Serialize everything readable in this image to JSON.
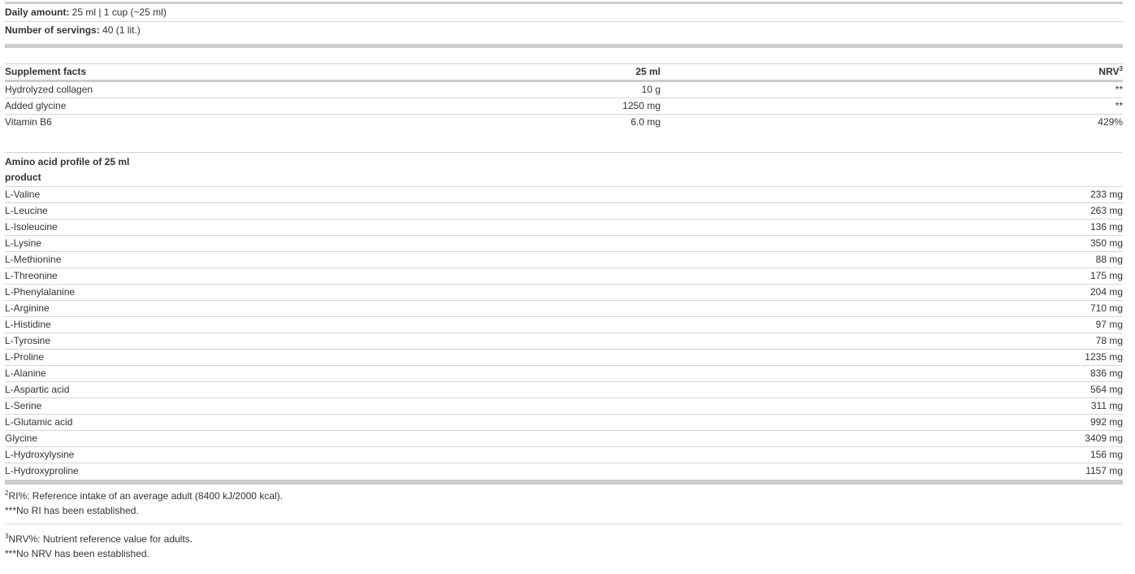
{
  "daily": {
    "label": "Daily amount:",
    "value": " 25 ml | 1 cup (~25 ml)"
  },
  "servings": {
    "label": "Number of servings:",
    "value": " 40 (1 lit.)"
  },
  "supplement": {
    "headers": {
      "name": "Supplement facts",
      "amount": "25 ml",
      "nrv": "NRV",
      "nrv_sup": "3"
    },
    "rows": [
      {
        "name": "Hydrolyzed collagen",
        "amount": "10 g",
        "nrv": "**"
      },
      {
        "name": "Added glycine",
        "amount": "1250 mg",
        "nrv": "**"
      },
      {
        "name": "Vitamin B6",
        "amount": "6.0 mg",
        "nrv": "429%"
      }
    ]
  },
  "amino": {
    "title_line1": "Amino acid profile of 25 ml",
    "title_line2": "product",
    "rows": [
      {
        "name": "L-Valine",
        "value": "233 mg"
      },
      {
        "name": "L-Leucine",
        "value": "263 mg"
      },
      {
        "name": "L-Isoleucine",
        "value": "136 mg"
      },
      {
        "name": "L-Lysine",
        "value": "350 mg"
      },
      {
        "name": "L-Methionine",
        "value": "88 mg"
      },
      {
        "name": "L-Threonine",
        "value": "175 mg"
      },
      {
        "name": "L-Phenylalanine",
        "value": "204 mg"
      },
      {
        "name": "L-Arginine",
        "value": "710 mg"
      },
      {
        "name": "L-Histidine",
        "value": "97 mg"
      },
      {
        "name": "L-Tyrosine",
        "value": "78 mg"
      },
      {
        "name": "L-Proline",
        "value": "1235 mg"
      },
      {
        "name": "L-Alanine",
        "value": "836 mg"
      },
      {
        "name": "L-Aspartic acid",
        "value": "564 mg"
      },
      {
        "name": "L-Serine",
        "value": "311 mg"
      },
      {
        "name": "L-Glutamic acid",
        "value": "992 mg"
      },
      {
        "name": "Glycine",
        "value": "3409 mg"
      },
      {
        "name": "L-Hydroxylysine",
        "value": "156 mg"
      },
      {
        "name": "L-Hydroxyproline",
        "value": "1157 mg"
      }
    ]
  },
  "notes": {
    "ri_sup": "2",
    "ri_text": "RI%: Reference intake of an average adult (8400 kJ/2000 kcal).",
    "ri_none": "***No RI has been established.",
    "nrv_sup": "3",
    "nrv_text": "NRV%: Nutrient reference value for adults.",
    "nrv_none": "***No NRV has been established."
  }
}
